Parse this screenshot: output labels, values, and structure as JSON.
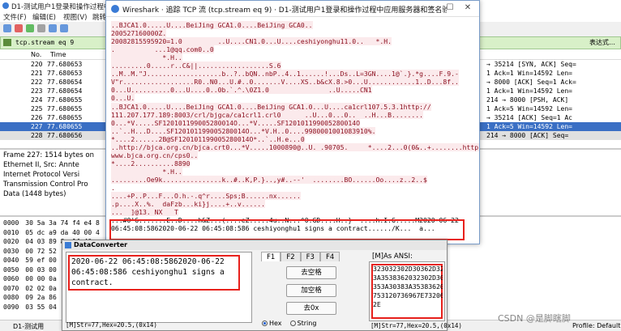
{
  "bg": {
    "title": "D1-测试用户1登录和操作过程中应用",
    "menu": [
      "文件(F)",
      "编辑(E)",
      "视图(V)",
      "跳转"
    ],
    "filter": "tcp.stream eq 9",
    "filter_right": "表达式…",
    "columns": {
      "no": "No.",
      "time": "Time"
    },
    "rows": [
      {
        "no": "220",
        "time": "77.680653",
        "info": "→ 35214 [SYN, ACK] Seq="
      },
      {
        "no": "221",
        "time": "77.680653",
        "info": "1 Ack=1 Win=14592 Len="
      },
      {
        "no": "222",
        "time": "77.680654",
        "info": "→ 8000 [ACK] Seq=1 Ack="
      },
      {
        "no": "223",
        "time": "77.680654",
        "info": "1 Ack=1 Win=14592 Len="
      },
      {
        "no": "224",
        "time": "77.680655",
        "info": "214 → 8000 [PSH, ACK]"
      },
      {
        "no": "225",
        "time": "77.680655",
        "info": "1 Ack=5 Win=14592 Len="
      },
      {
        "no": "226",
        "time": "77.680655",
        "info": "→ 35214 [ACK] Seq=1 Ac"
      },
      {
        "no": "227",
        "time": "77.680655",
        "info": "1 Ack=5 Win=14592 Len="
      },
      {
        "no": "228",
        "time": "77.680656",
        "info": "214 → 8000 [ACK] Seq="
      }
    ],
    "detail": [
      "Frame 227: 1514 bytes on",
      "Ethernet II, Src: Annte",
      "Internet Protocol Versi",
      "Transmission Control Pro",
      "Data (1448 bytes)"
    ],
    "hex": [
      {
        "off": "0000",
        "bytes": "30 5a 3a 74 f4 e4 8"
      },
      {
        "off": "0010",
        "bytes": "05 dc a9 da 40 00 4"
      },
      {
        "off": "0020",
        "bytes": "04 03 89 8e 1f 40 a"
      },
      {
        "off": "0030",
        "bytes": "00 72 52"
      },
      {
        "off": "0040",
        "bytes": "59 ef 00"
      },
      {
        "off": "0050",
        "bytes": "00 03 00"
      },
      {
        "off": "0060",
        "bytes": "00 00 0a"
      },
      {
        "off": "0070",
        "bytes": "02 02 0a"
      },
      {
        "off": "0080",
        "bytes": "09 2a 86"
      },
      {
        "off": "0090",
        "bytes": "03 55 04"
      }
    ],
    "status": "D1-测试用",
    "right_status": "Profile: Default"
  },
  "stream": {
    "title": "Wireshark · 追踪 TCP 流 (tcp.stream eq 9) · D1-测试用户1登录和操作过程中应用服务器和签名验签服务器之间的通信数据.pcap",
    "lines": [
      "..BJCA1.0.....U....BeiJing GCA1.0....BeiJing GCA0..",
      "200527160000Z.",
      "20082815595920=1.0         ..U....CN1.0...U....ceshiyonghu11.0..   *.H.",
      ".          ...1@qq.com0..0",
      "             *.H..",
      ".........0.....r..C&||..................S.6",
      "..M..M.\"J...................b..?..bQN..nbP..4..1......!...Ds..L=3GN....1@`.}.*g....F.9.-",
      "V\"r..................R0..N0...U.#..0.......V....XS..b&cX.8.>0...U............1..D...8f..",
      "0...U..........0...U....0..0b.`.^.\\0Z1.0               ..U.....CN1",
      "0...U.",
      "..BJCA1.0.....U....BeiJing GCA1.0....BeiJing GCA1.0...U....ca1crl107.5.3.1http://",
      "111.207.177.189:8003/crl/bjgca/ca1crl1.crl0      ..U...0...0..  ..H...B........",
      "0...*V.....SF120101199005280014O...*V.....SF120101199005280014O",
      "..`..H...D....SF120101199005280014O...*V.H..0....9980001001083910%.",
      "*....2......2B@SF120101199005280014O*..`..H.e...0",
      "..http://bjca.org.cn/bjca.crt0...*V.....1000890@..U. .90705.     *....2...0(0&..+........http://",
      "www.bjca.org.cn/cps0..",
      "*....2..........8890",
      "             *.H..",
      ".........Oe9k...............k..#..K,P.}..,y#..--'  ........BO......Oo....z..2..$",
      ".",
      "....+P..P...F...O.h.-.q^r....Sps;B......nx......",
      ".p....X..%.  daFzb...ki}j....+..v......",
      "...  ]@13. NX   T",
      "...#0'6.......E..D....h&Z...(....eZ.....4u..N...^0.GD....H..}  ....h.I.G.....M2020-06-22",
      "06:45:08:5862020-06-22 06:45:08:586 ceshiyonghu1 signs a contract....../K...  a..."
    ]
  },
  "dc": {
    "title": "DataConverter",
    "left_text": "2020-06-22 06:45:08:5862020-06-22\n06:45:08:586 ceshiyonghu1 signs a\ncontract.",
    "left_status": "[M]Str=77,Hex=20.5,(0x14)",
    "tabs": [
      "F1",
      "F2",
      "F3",
      "F4"
    ],
    "btn_remove_spaces": "去空格",
    "btn_add_spaces": "加空格",
    "btn_remove_0x": "去0x",
    "radio_hex": "Hex",
    "radio_string": "String",
    "right_label": "[M]As ANSI:",
    "right_text": "323032302D30362D32322030363A34353A3038\n3A3538362032302D30362D32322030363A34\n353A30383A3538362063657368697966E6768\n753120736967E73206120636F6E7472616374\n2E",
    "right_status": "[M]Str=77,Hex=20.5,(0x14)"
  },
  "watermark": "CSDN @是脚瞎脚"
}
